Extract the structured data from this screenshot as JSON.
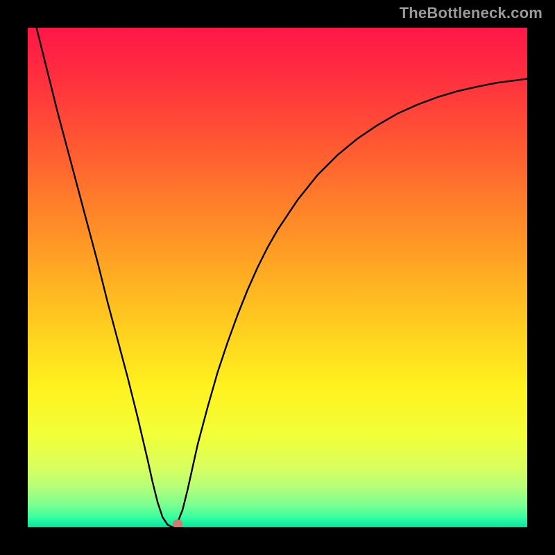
{
  "watermark": "TheBottleneck.com",
  "chart_data": {
    "type": "line",
    "title": "",
    "xlabel": "",
    "ylabel": "",
    "xlim": [
      0,
      100
    ],
    "ylim": [
      0,
      100
    ],
    "grid": false,
    "legend": false,
    "series": [
      {
        "name": "bottleneck-curve",
        "x": [
          0,
          2,
          4,
          6,
          8,
          10,
          12,
          14,
          16,
          18,
          20,
          22,
          24,
          25,
          26,
          27,
          28,
          29,
          30,
          31,
          32,
          33,
          34,
          36,
          38,
          40,
          42,
          44,
          46,
          48,
          50,
          54,
          58,
          62,
          66,
          70,
          74,
          78,
          82,
          86,
          90,
          94,
          98,
          100
        ],
        "values": [
          107,
          99,
          91,
          83,
          75.5,
          68,
          60.5,
          53,
          45,
          37.5,
          30,
          22,
          13.5,
          9,
          5,
          2,
          0.5,
          0,
          1,
          3.5,
          7.5,
          12,
          16.5,
          24,
          31,
          37,
          42.5,
          47.5,
          52,
          56,
          59.5,
          65.5,
          70.5,
          74.5,
          77.8,
          80.5,
          82.8,
          84.6,
          86.1,
          87.3,
          88.2,
          89,
          89.5,
          89.8
        ]
      }
    ],
    "marker": {
      "x": 30,
      "y": 0.6,
      "color": "#cf7b6e"
    },
    "gradient_stops": [
      {
        "offset": 0.0,
        "color": "#ff1747"
      },
      {
        "offset": 0.1,
        "color": "#ff2f3f"
      },
      {
        "offset": 0.22,
        "color": "#ff5433"
      },
      {
        "offset": 0.35,
        "color": "#ff7e2a"
      },
      {
        "offset": 0.48,
        "color": "#ffa723"
      },
      {
        "offset": 0.6,
        "color": "#ffce1f"
      },
      {
        "offset": 0.72,
        "color": "#fff21f"
      },
      {
        "offset": 0.82,
        "color": "#f0ff3a"
      },
      {
        "offset": 0.88,
        "color": "#d8ff5e"
      },
      {
        "offset": 0.92,
        "color": "#b4ff7a"
      },
      {
        "offset": 0.955,
        "color": "#7bff8e"
      },
      {
        "offset": 0.978,
        "color": "#3effa0"
      },
      {
        "offset": 1.0,
        "color": "#00e6a2"
      }
    ]
  }
}
